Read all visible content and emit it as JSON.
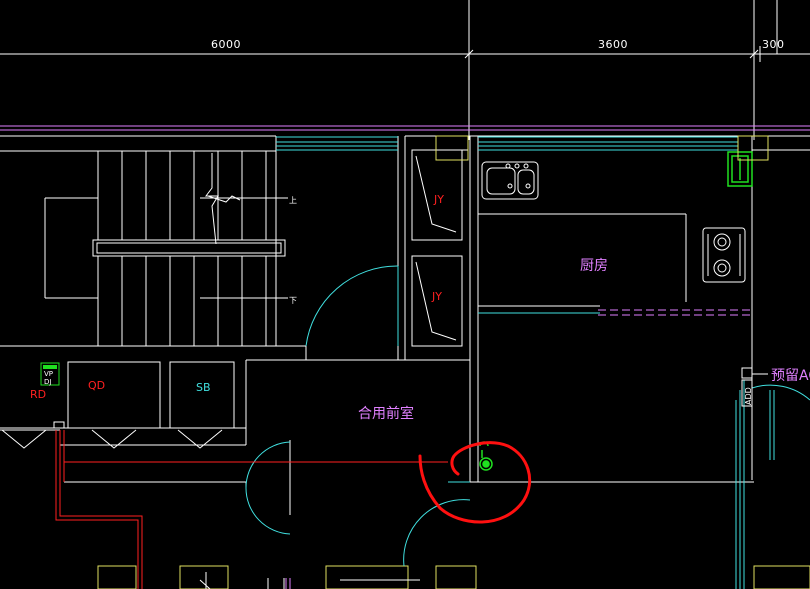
{
  "dimensions": [
    "6000",
    "3600",
    "300"
  ],
  "labels": {
    "jy_upper": "JY",
    "jy_lower": "JY",
    "kitchen": "厨房",
    "shared_lobby": "合用前室",
    "reserved": "预留AC",
    "add": "ADD",
    "qd": "QD",
    "sb": "SB",
    "rd": "RD",
    "vp": "VP",
    "dj": "DJ",
    "stair_up": "上",
    "stair_down": "下"
  },
  "colors": {
    "background": "#000000",
    "wall": "#ffffff",
    "cyan": "#40e0e0",
    "red": "#ff2020",
    "magenta": "#e080ff",
    "green": "#20e020",
    "yellow": "#e0e060",
    "markup": "#ff1010"
  }
}
